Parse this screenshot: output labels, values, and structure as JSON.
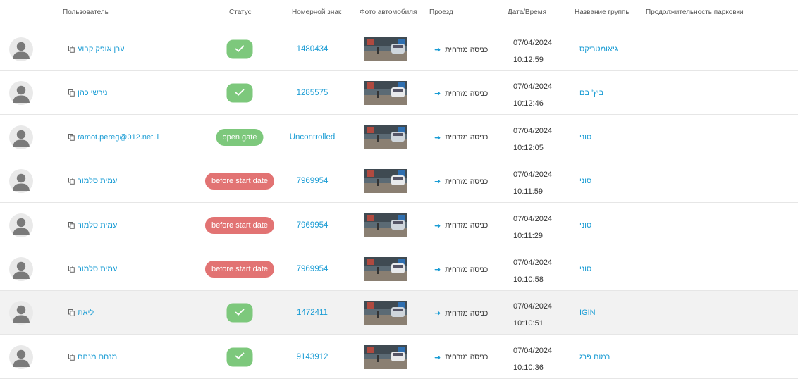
{
  "colors": {
    "link": "#1a9cd4",
    "success": "#7dc87c",
    "danger": "#e27373",
    "row_highlight": "#f2f2f2"
  },
  "header": {
    "user": "Пользователь",
    "status": "Статус",
    "plate": "Номерной знак",
    "photo": "Фото автомобиля",
    "passage": "Проезд",
    "datetime": "Дата/Время",
    "group": "Название группы",
    "duration": "Продолжительность парковки"
  },
  "rows": [
    {
      "user": "ערן אופק קבוע",
      "status_type": "check",
      "status_label": "",
      "plate": "1480434",
      "passage": "כניסה מזרחית",
      "date": "07/04/2024",
      "time": "10:12:59",
      "group": "גיאומטריקס",
      "highlight": false
    },
    {
      "user": "נירשי כהן",
      "status_type": "check",
      "status_label": "",
      "plate": "1285575",
      "passage": "כניסה מזרחית",
      "date": "07/04/2024",
      "time": "10:12:46",
      "group": "ביץ' בם",
      "highlight": false
    },
    {
      "user": "ramot.pereg@012.net.il",
      "status_type": "success",
      "status_label": "open gate",
      "plate": "Uncontrolled",
      "passage": "כניסה מזרחית",
      "date": "07/04/2024",
      "time": "10:12:05",
      "group": "סוני",
      "highlight": false
    },
    {
      "user": "עמית סלמור",
      "status_type": "danger",
      "status_label": "before start date",
      "plate": "7969954",
      "passage": "כניסה מזרחית",
      "date": "07/04/2024",
      "time": "10:11:59",
      "group": "סוני",
      "highlight": false
    },
    {
      "user": "עמית סלמור",
      "status_type": "danger",
      "status_label": "before start date",
      "plate": "7969954",
      "passage": "כניסה מזרחית",
      "date": "07/04/2024",
      "time": "10:11:29",
      "group": "סוני",
      "highlight": false
    },
    {
      "user": "עמית סלמור",
      "status_type": "danger",
      "status_label": "before start date",
      "plate": "7969954",
      "passage": "כניסה מזרחית",
      "date": "07/04/2024",
      "time": "10:10:58",
      "group": "סוני",
      "highlight": false
    },
    {
      "user": "ליאת",
      "status_type": "check",
      "status_label": "",
      "plate": "1472411",
      "passage": "כניסה מזרחית",
      "date": "07/04/2024",
      "time": "10:10:51",
      "group": "IGIN",
      "highlight": true
    },
    {
      "user": "מנחם מנחם",
      "status_type": "check",
      "status_label": "",
      "plate": "9143912",
      "passage": "כניסה מזרחית",
      "date": "07/04/2024",
      "time": "10:10:36",
      "group": "רמות פרג",
      "highlight": false
    }
  ]
}
